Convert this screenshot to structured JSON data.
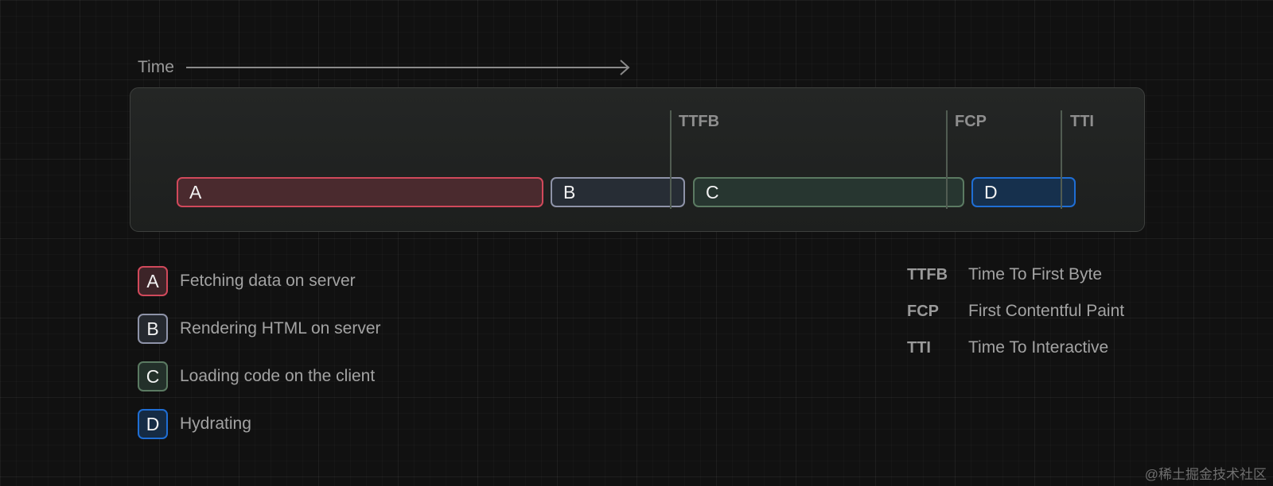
{
  "axis": {
    "label": "Time"
  },
  "colors": {
    "A": "#d1495b",
    "B": "#8e93a8",
    "C": "#5b7a62",
    "D": "#1f6ed4"
  },
  "bars": [
    {
      "letter": "A"
    },
    {
      "letter": "B"
    },
    {
      "letter": "C"
    },
    {
      "letter": "D"
    }
  ],
  "markers": [
    {
      "label": "TTFB"
    },
    {
      "label": "FCP"
    },
    {
      "label": "TTI"
    }
  ],
  "legend": [
    {
      "letter": "A",
      "text": "Fetching data on server"
    },
    {
      "letter": "B",
      "text": "Rendering HTML on server"
    },
    {
      "letter": "C",
      "text": "Loading code on the client"
    },
    {
      "letter": "D",
      "text": "Hydrating"
    }
  ],
  "abbreviations": [
    {
      "key": "TTFB",
      "value": "Time To First Byte"
    },
    {
      "key": "FCP",
      "value": "First Contentful Paint"
    },
    {
      "key": "TTI",
      "value": "Time To Interactive"
    }
  ],
  "watermark": "@稀土掘金技术社区"
}
